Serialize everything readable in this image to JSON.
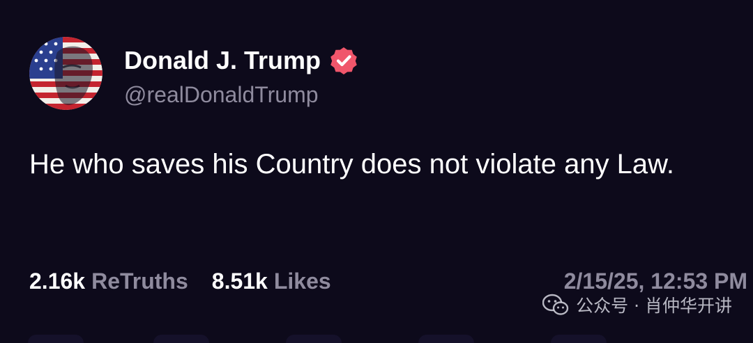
{
  "post": {
    "author": {
      "display_name": "Donald J. Trump",
      "handle": "@realDonaldTrump",
      "avatar_icon": "avatar-flag-portrait",
      "verified_icon": "verified-badge-icon",
      "verified_color": "#f0566b"
    },
    "text": "He who saves his Country does not violate any Law.",
    "stats": {
      "retruths_count": "2.16k",
      "retruths_label": "ReTruths",
      "likes_count": "8.51k",
      "likes_label": "Likes"
    },
    "timestamp": "2/15/25, 12:53 PM"
  },
  "watermark": {
    "icon": "wechat-icon",
    "text": "公众号 · 肖仲华开讲"
  },
  "colors": {
    "background": "#0d0a1b",
    "primary_text": "#ffffff",
    "secondary_text": "#8f8b9e",
    "accent": "#f0566b"
  }
}
